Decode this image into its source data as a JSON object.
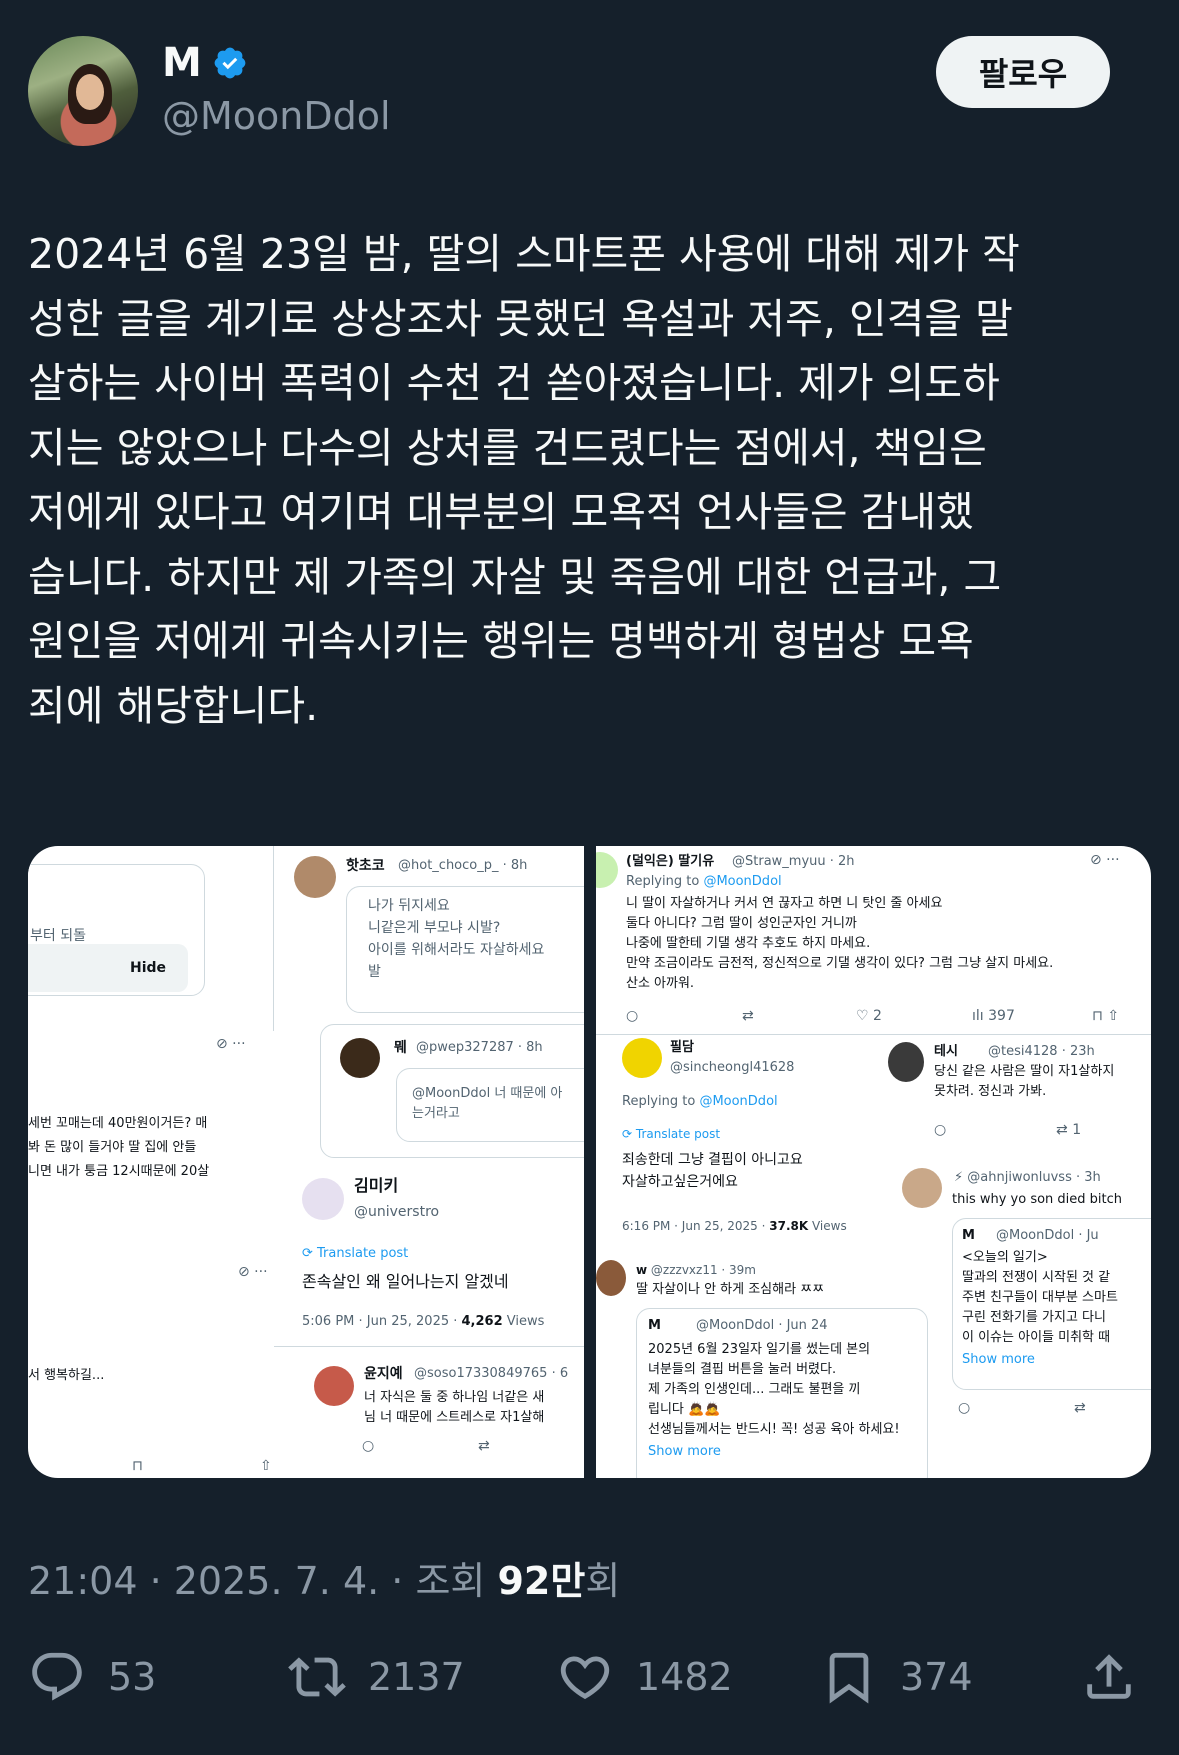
{
  "author": {
    "name": "M",
    "handle": "@MoonDdol",
    "verified": true,
    "follow_label": "팔로우"
  },
  "tweet": {
    "text": "2024년 6월 23일 밤, 딸의 스마트폰 사용에 대해 제가 작\n성한 글을 계기로 상상조차 못했던 욕설과 저주, 인격을 말\n살하는 사이버 폭력이 수천 건 쏟아졌습니다. 제가 의도하\n지는 않았으나 다수의 상처를 건드렸다는 점에서, 책임은\n저에게 있다고 여기며 대부분의 모욕적 언사들은 감내했\n습니다. 하지만 제 가족의 자살 및 죽음에 대한 언급과, 그\n원인을 저에게 귀속시키는 행위는 명백하게 형법상 모욕\n죄에 해당합니다.",
    "time": "21:04 · 2025. 7. 4. · 조회",
    "views": "92만",
    "views_suffix": "회"
  },
  "actions": {
    "replies": "53",
    "retweets": "2137",
    "likes": "1482",
    "bookmarks": "374"
  },
  "icons": [
    "verified-badge-icon",
    "reply-icon",
    "retweet-icon",
    "like-icon",
    "bookmark-icon",
    "share-icon"
  ],
  "colors": {
    "background": "#15202b",
    "accent": "#1d9bf0",
    "muted": "#8b98a5"
  },
  "media_left": {
    "hide_snippet": "부터 되돌",
    "hide_label": "Hide",
    "left_lines": [
      "세번 꼬매는데 40만원이거든? 매",
      "봐 돈 많이 들거야 딸 집에 안들",
      "니면 내가 퉁금 12시때문에 20살"
    ],
    "left_bottom": "서 행복하길...",
    "p1_name": "핫초코",
    "p1_handle": "@hot_choco_p_ · 8h",
    "p1_lines": [
      "나가 뒤지세요",
      "니같은게 부모냐 시발?",
      "아이를 위해서라도 자살하세요",
      "발"
    ],
    "p2_name": "뭬",
    "p2_handle": "@pwep327287 · 8h",
    "p2_lines": [
      "@MoonDdol 너 때문에 아",
      "는거라고"
    ],
    "p3_name": "김미키",
    "p3_handle": "@universtro",
    "translate": "Translate post",
    "p3_text": "존속살인 왜 일어나는지 알겠네",
    "p3_time": "5:06 PM · Jun 25, 2025 · ",
    "p3_views": "4,262",
    "views_word": "Views",
    "p4_name": "윤지예",
    "p4_handle": "@soso17330849765 · 6",
    "p4_lines": [
      "너 자식은 둘 중 하나임 너같은 새",
      "님 너 때문에 스트레스로 자1살해"
    ]
  },
  "media_right": {
    "r1_name": "(덜익은) 딸기유",
    "r1_handle": "@Straw_myuu · 2h",
    "replying": "Replying to",
    "replying_to": "@MoonDdol",
    "r1_lines": [
      "니 딸이 자살하거나 커서 연 끊자고 하면 니 탓인 줄 아세요",
      "둘다 아니다? 그럼 딸이 성인군자인 거니까",
      "나중에 딸한테 기댈 생각 추호도 하지 마세요.",
      "만약 조금이라도 금전적, 정신적으로 기댈 생각이 있다? 그럼 그냥 살지 마세요.",
      "산소 아까워."
    ],
    "r1_likes": "2",
    "r1_views": "397",
    "r2_name": "필담",
    "r2_handle": "@sincheongl41628",
    "translate": "Translate post",
    "r2_lines": [
      "죄송한데 그냥 결핍이 아니고요",
      "자살하고싶은거에요"
    ],
    "r2_time": "6:16 PM · Jun 25, 2025 · ",
    "r2_views": "37.8K",
    "views_word": "Views",
    "r3_name": "테시",
    "r3_handle": "@tesi4128 · 23h",
    "r3_lines": [
      "당신 같은 사람은 딸이 자1살하지",
      "못차려. 정신과 가봐."
    ],
    "r3_rt": "1",
    "r4_handle": "@ahnjiwonluvss · 3h",
    "r4_text": "this why yo son died bitch",
    "q1_name": "M",
    "q1_handle": "@MoonDdol · Ju",
    "q1_lines": [
      "<오늘의 일기>",
      "딸과의 전쟁이 시작된 것 같",
      "주변 친구들이 대부분 스마트",
      "구린 전화기를 가지고 다니",
      "이 이슈는 아이들 미취학 때"
    ],
    "show_more": "Show more",
    "r5_handle": "@zzzvxz11 · 39m",
    "r5_text": "딸 자살이나 안 하게 조심해라 ㅉㅉ",
    "q2_name": "M",
    "q2_handle": "@MoonDdol · Jun 24",
    "q2_lines": [
      "2025년 6월 23일자 일기를 썼는데 본의",
      "녀분들의 결핍 버튼을 눌러 버렸다.",
      "제 가족의 인생인데... 그래도 불편을 끼",
      "립니다 🙇🙇",
      "선생님들께서는 반드시! 꼭! 성공 육아 하세요!"
    ]
  }
}
